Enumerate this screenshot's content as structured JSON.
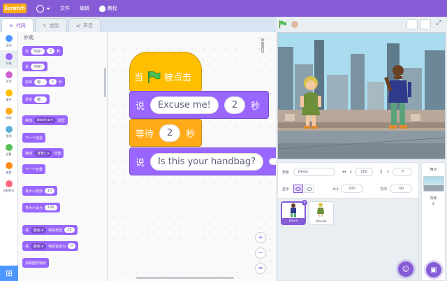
{
  "menu": {
    "logo": "Scratch",
    "file": "文件",
    "edit": "编辑",
    "tutorials": "教程"
  },
  "tabs": [
    {
      "label": "代码"
    },
    {
      "label": "造型"
    },
    {
      "label": "声音"
    }
  ],
  "categories": [
    {
      "label": "运动",
      "color": "#4c97ff"
    },
    {
      "label": "外观",
      "color": "#9966ff"
    },
    {
      "label": "声音",
      "color": "#cf63cf"
    },
    {
      "label": "事件",
      "color": "#ffbf00"
    },
    {
      "label": "控制",
      "color": "#ffab19"
    },
    {
      "label": "侦测",
      "color": "#5cb1d6"
    },
    {
      "label": "运算",
      "color": "#59c059"
    },
    {
      "label": "变量",
      "color": "#ff8c1a"
    },
    {
      "label": "自制积木",
      "color": "#ff6680"
    }
  ],
  "palette": {
    "heading": "外观",
    "blocks": [
      {
        "text": "说",
        "a1": "你好!",
        "a2": "2",
        "tail": "秒"
      },
      {
        "text": "说",
        "a1": "你好!"
      },
      {
        "text": "思考",
        "a1": "嗯...",
        "a2": "2",
        "tail": "秒"
      },
      {
        "text": "思考",
        "a1": "嗯..."
      },
      {
        "text": "换成",
        "d1": "devin-a",
        "tail": "造型"
      },
      {
        "text": "下一个造型"
      },
      {
        "text": "换成",
        "d1": "背景1",
        "tail": "背景"
      },
      {
        "text": "下一个背景"
      },
      {
        "text": "将大小增加",
        "a1": "10"
      },
      {
        "text": "将大小设为",
        "a1": "100"
      },
      {
        "text": "将",
        "d1": "颜色",
        "tail": "特效增加",
        "a2": "25"
      },
      {
        "text": "将",
        "d1": "颜色",
        "tail": "特效设定为",
        "a2": "0"
      },
      {
        "text": "清除图形特效"
      }
    ]
  },
  "script": {
    "hat_when": "当",
    "hat_clicked": "被点击",
    "say1_label": "说",
    "say1_text": "Excuse me!",
    "say1_secs": "2",
    "say1_unit": "秒",
    "wait_label": "等待",
    "wait_secs": "2",
    "wait_unit": "秒",
    "say2_label": "说",
    "say2_text": "Is this your handbag?"
  },
  "zoom": {
    "in": "+",
    "out": "−",
    "reset": "="
  },
  "sprite_info": {
    "sprite_label": "角色",
    "sprite_name": "Devin",
    "x": "100",
    "y": "-7",
    "show_label": "显示",
    "size_label": "大小",
    "size": "100",
    "direction_label": "方向",
    "direction": "-90"
  },
  "sprites": [
    {
      "name": "Devin",
      "selected": true
    },
    {
      "name": "Wanda",
      "selected": false
    }
  ],
  "stage_panel": {
    "label": "舞台",
    "backdrops_label": "背景",
    "backdrops_count": "2"
  }
}
